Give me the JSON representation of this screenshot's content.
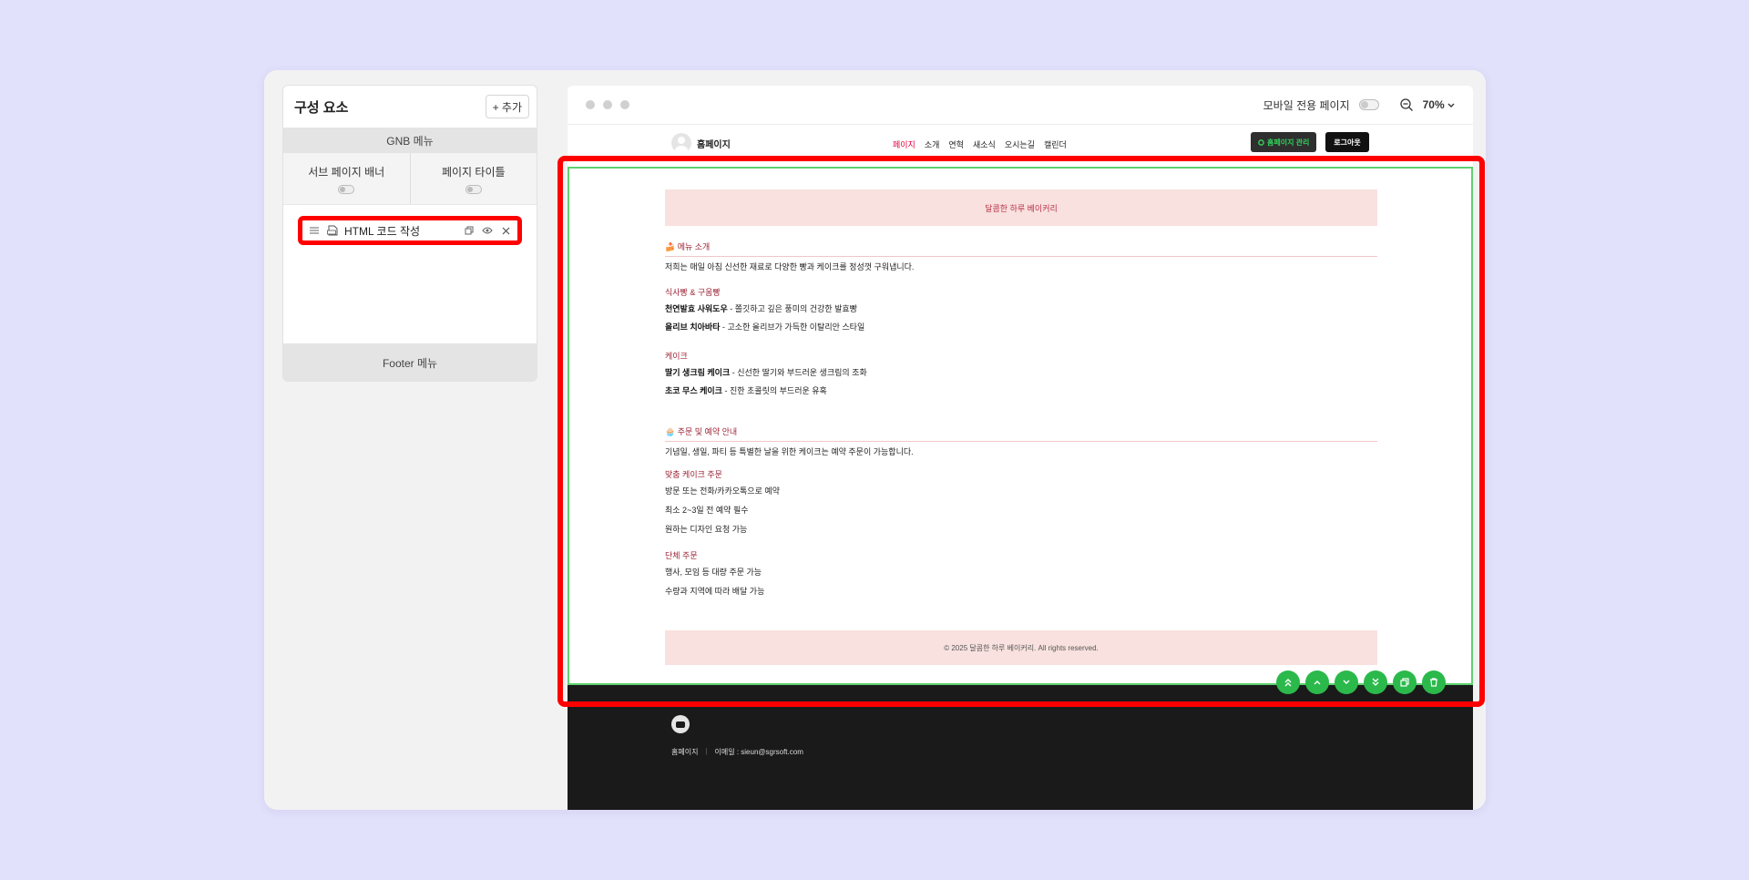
{
  "panel": {
    "title": "구성 요소",
    "add_label": "+ 추가",
    "gnb_label": "GNB 메뉴",
    "toggle_sub_banner": "서브 페이지 배너",
    "toggle_page_title": "페이지 타이틀",
    "component_label": "HTML 코드 작성",
    "footer_label": "Footer 메뉴"
  },
  "toolbar": {
    "mobile_label": "모바일 전용 페이지",
    "zoom": "70%"
  },
  "site": {
    "logo_text": "홈페이지",
    "nav": [
      "페이지",
      "소개",
      "연혁",
      "새소식",
      "오시는길",
      "캘린더"
    ],
    "admin_btn": "홈페이지 관리",
    "logout_btn": "로그아웃"
  },
  "html": {
    "banner": "달콤한 하루 베이커리",
    "menu_title": "🍰 메뉴 소개",
    "menu_intro": "저희는 매일 아침 신선한 재료로 다양한 빵과 케이크를 정성껏 구워냅니다.",
    "bread_title": "식사빵 & 구움빵",
    "bread1_name": "천연발효 사워도우",
    "bread1_desc": " - 쫄깃하고 깊은 풍미의 건강한 발효빵",
    "bread2_name": "올리브 치아바타",
    "bread2_desc": " - 고소한 올리브가 가득한 이탈리안 스타일",
    "cake_title": "케이크",
    "cake1_name": "딸기 생크림 케이크",
    "cake1_desc": " - 신선한 딸기와 부드러운 생크림의 조화",
    "cake2_name": "초코 무스 케이크",
    "cake2_desc": " - 진한 초콜릿의 부드러운 유혹",
    "order_title": "🧁 주문 및 예약 안내",
    "order_intro": "기념일, 생일, 파티 등 특별한 날을 위한 케이크는 예약 주문이 가능합니다.",
    "custom_title": "맞춤 케이크 주문",
    "custom1": "방문 또는 전화/카카오톡으로 예약",
    "custom2": "최소 2~3일 전 예약 필수",
    "custom3": "원하는 디자인 요청 가능",
    "group_title": "단체 주문",
    "group1": "행사, 모임 등 대량 주문 가능",
    "group2": "수량과 지역에 따라 배달 가능",
    "copyright": "© 2025 달콤한 하루 베이커리. All rights reserved."
  },
  "footer": {
    "home": "홈페이지",
    "email": "이메일 : sieun@sgrsoft.com"
  },
  "colors": {
    "accent_green": "#2bb94b",
    "selection_red": "#ff0000",
    "banner_pink": "#f8e1de"
  }
}
